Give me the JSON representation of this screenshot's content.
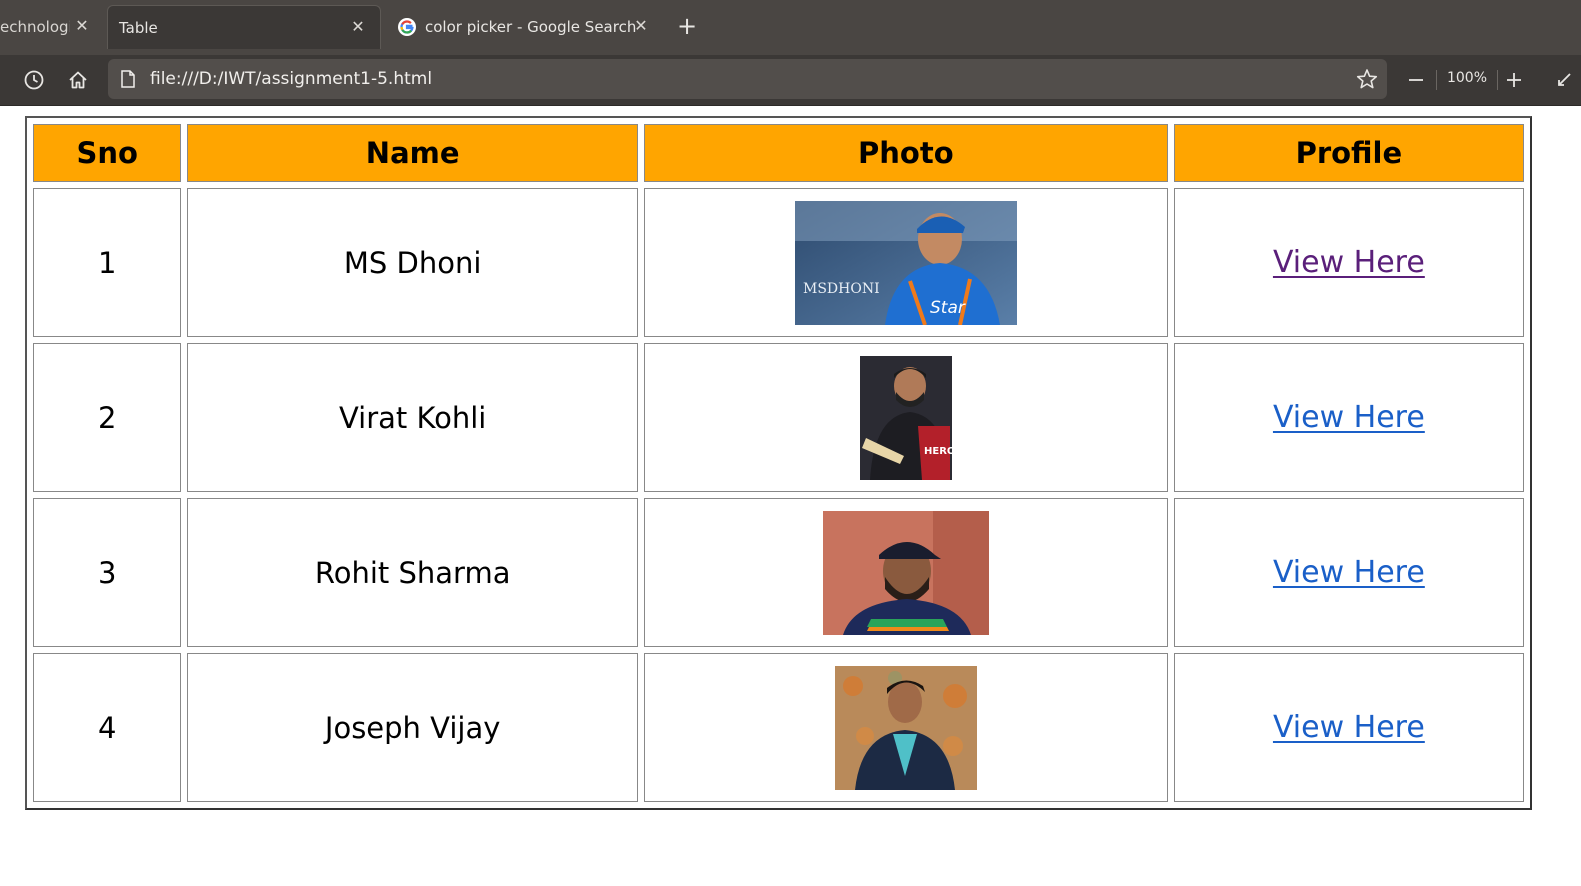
{
  "browser": {
    "tabs": [
      {
        "title": "echnologie",
        "active": false
      },
      {
        "title": "Table",
        "active": true
      },
      {
        "title": "color picker - Google Search",
        "active": false
      }
    ],
    "address": "file:///D:/IWT/assignment1-5.html",
    "zoom": "100%"
  },
  "table": {
    "headers": [
      "Sno",
      "Name",
      "Photo",
      "Profile"
    ],
    "rows": [
      {
        "sno": "1",
        "name": "MS Dhoni",
        "photo_caption": "MSDHONI",
        "photo_logo": "Star",
        "profile": "View Here",
        "visited": true
      },
      {
        "sno": "2",
        "name": "Virat Kohli",
        "photo_logo": "HERO",
        "profile": "View Here",
        "visited": false
      },
      {
        "sno": "3",
        "name": "Rohit Sharma",
        "profile": "View Here",
        "visited": false
      },
      {
        "sno": "4",
        "name": "Joseph Vijay",
        "profile": "View Here",
        "visited": false
      }
    ]
  },
  "colors": {
    "header_bg": "#ffa500",
    "link": "#1a5fc8",
    "link_visited": "#5a1f7a"
  }
}
